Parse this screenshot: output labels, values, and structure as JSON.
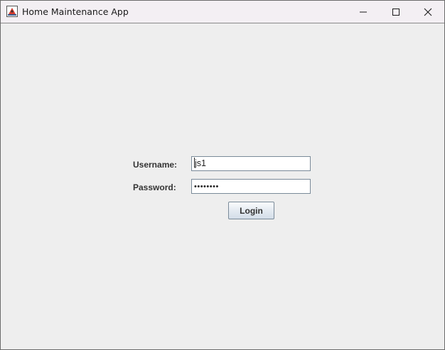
{
  "window": {
    "title": "Home Maintenance App",
    "icon": "java-app-icon",
    "controls": [
      "minimize-icon",
      "maximize-icon",
      "close-icon"
    ]
  },
  "login_form": {
    "username_label": "Username:",
    "username_value": "js1",
    "password_label": "Password:",
    "password_masked": "••••••••",
    "login_button": "Login"
  },
  "colors": {
    "window_background": "#eeeeee",
    "titlebar_background": "#f3eff3",
    "button_border": "#7a8a99"
  }
}
